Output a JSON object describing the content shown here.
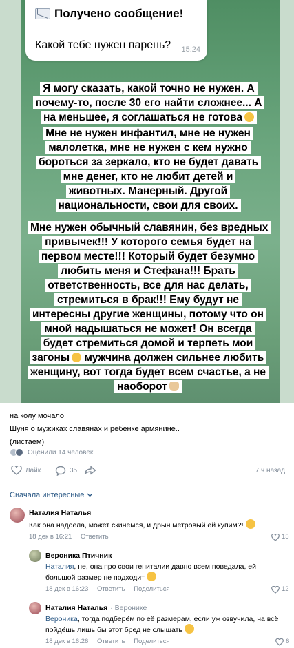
{
  "story": {
    "message_title": "Получено сообщение!",
    "message_text": "Какой тебе нужен парень?",
    "message_time": "15:24",
    "caption1": "Я могу сказать, какой точно не нужен. А почему-то, после 30 его найти сложнее... А на меньшее, я соглашаться не готова",
    "caption2": "Мне не нужен инфантил, мне не нужен малолетка, мне не нужен с кем нужно бороться за зеркало, кто не будет давать мне денег, кто не любит детей и животных. Манерный. Другой национальности, свои для своих.",
    "caption3": "Мне нужен обычный славянин, без вредных привычек!!! У которого семья будет на первом месте!!! Который будет безумно любить меня и Стефана!!! Брать ответственность, все для нас делать, стремиться в брак!!! Ему будут не интересны другие женщины, потому что он мной надышаться не может! Он всегда будет стремиться домой и терпеть мои загоны",
    "caption3_tail": "мужчина должен сильнее любить женщину, вот тогда будет всем счастье, а не наоборот"
  },
  "post": {
    "line1": "на колу мочало",
    "line2": "Шуня о мужиках славянах и ребенке армянине..",
    "line3": "(листаем)",
    "rated": "Оценили 14 человек",
    "like_label": "Лайк",
    "comments_count": "35",
    "time": "7 ч назад"
  },
  "sort_label": "Сначала интересные",
  "comments": [
    {
      "author": "Наталия Наталья",
      "reply_to": "",
      "mention": "",
      "text": "Как она надоела, может скинемся, и дрын метровый ей купим?!",
      "date": "18 дек в 16:21",
      "reply": "Ответить",
      "likes": "15",
      "avatar_color": "#9b4a55"
    },
    {
      "author": "Вероника Птичник",
      "reply_to": "",
      "mention": "Наталия",
      "text": ", не, она про свои гениталии давно всем поведала, ей большой размер не подходит",
      "date": "18 дек в 16:23",
      "reply": "Ответить",
      "share": "Поделиться",
      "likes": "12",
      "avatar_color": "#6f7a5c"
    },
    {
      "author": "Наталия Наталья",
      "reply_to": "Веронике",
      "mention": "Вероника",
      "text": ", тогда подберём по её размерам, если уж озвучила, на всё пойдёшь лишь бы этот бред не слышать",
      "date": "18 дек в 16:26",
      "reply": "Ответить",
      "share": "Поделиться",
      "likes": "6",
      "avatar_color": "#9b4a55"
    }
  ]
}
